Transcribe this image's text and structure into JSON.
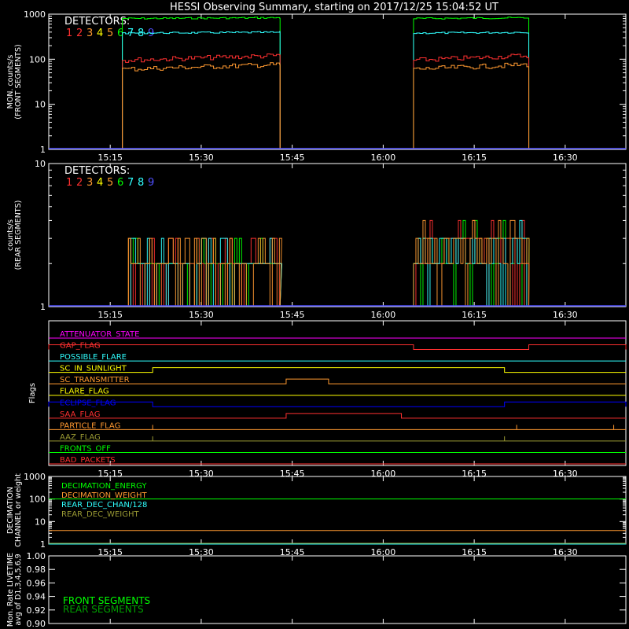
{
  "title": "HESSI Observing Summary, starting on 2017/12/25 15:04:52 UT",
  "colors": {
    "background": "#000000",
    "axes": "#ffffff",
    "det1": "#ff3030",
    "det2": "#ff3030",
    "det3": "#ff9930",
    "det4": "#ffff00",
    "det5": "#ff9930",
    "det6": "#00ff00",
    "det7": "#30ffff",
    "det8": "#30ffff",
    "det9": "#5050ff"
  },
  "time_ticks": [
    "15:15",
    "15:30",
    "15:45",
    "16:00",
    "16:15",
    "16:30"
  ],
  "chart_data": [
    {
      "type": "line",
      "ylabel": "MON. counts/s\n(FRONT SEGMENTS)",
      "yscale": "log",
      "ylim": [
        1,
        1000
      ],
      "yticks": [
        "1",
        "10",
        "100",
        "1000"
      ],
      "legend_title": "DETECTORS:",
      "legend_items": [
        "1",
        "2",
        "3",
        "4",
        "5",
        "6",
        "7",
        "8",
        "9"
      ],
      "intervals": [
        [
          "15:17",
          "15:43"
        ],
        [
          "16:05",
          "16:24"
        ]
      ],
      "series": [
        {
          "detector": "6",
          "color": "#00ff00",
          "level": 800
        },
        {
          "detector": "7",
          "color": "#30ffff",
          "level": 380
        },
        {
          "detector": "1",
          "color": "#ff3030",
          "level": 95
        },
        {
          "detector": "3",
          "color": "#ff9930",
          "level": 60
        }
      ]
    },
    {
      "type": "line",
      "ylabel": "counts/s\n(REAR SEGMENTS)",
      "yscale": "log",
      "ylim": [
        1,
        10
      ],
      "yticks": [
        "1",
        "10"
      ],
      "legend_title": "DETECTORS:",
      "legend_items": [
        "1",
        "2",
        "3",
        "4",
        "5",
        "6",
        "7",
        "8",
        "9"
      ],
      "intervals": [
        [
          "15:18",
          "15:43"
        ],
        [
          "16:05",
          "16:24"
        ]
      ],
      "levels": [
        1,
        2,
        3,
        4
      ]
    },
    {
      "type": "line",
      "ylabel": "Flags",
      "flags": [
        {
          "name": "ATTENUATOR_STATE",
          "color": "#ff00ff",
          "high": []
        },
        {
          "name": "GAP_FLAG",
          "color": "#ff3030",
          "high": [
            [
              "15:04:52",
              "16:05"
            ],
            [
              "16:24",
              "16:40"
            ]
          ]
        },
        {
          "name": "POSSIBLE_FLARE",
          "color": "#30ffff",
          "high": []
        },
        {
          "name": "SC_IN_SUNLIGHT",
          "color": "#ffff00",
          "high": [
            [
              "15:22",
              "16:20"
            ]
          ]
        },
        {
          "name": "SC_TRANSMITTER",
          "color": "#ff9930",
          "high": [
            [
              "15:44",
              "15:51"
            ]
          ]
        },
        {
          "name": "FLARE_FLAG",
          "color": "#ffff00",
          "high": []
        },
        {
          "name": "ECLIPSE_FLAG",
          "color": "#0000ff",
          "high": [
            [
              "15:04:52",
              "15:22"
            ],
            [
              "16:20",
              "16:40"
            ]
          ]
        },
        {
          "name": "SAA_FLAG",
          "color": "#ff3030",
          "high": [
            [
              "15:44",
              "16:03"
            ]
          ]
        },
        {
          "name": "PARTICLE_FLAG",
          "color": "#ff9930",
          "high": []
        },
        {
          "name": "AAZ_FLAG",
          "color": "#999933",
          "high": []
        },
        {
          "name": "FRONTS_OFF",
          "color": "#00ff00",
          "high": []
        },
        {
          "name": "BAD_PACKETS",
          "color": "#ff3030",
          "high": []
        }
      ]
    },
    {
      "type": "line",
      "ylabel": "DECIMATION\nCHANNEL or weight",
      "yscale": "log",
      "ylim": [
        1,
        1000
      ],
      "yticks": [
        "1",
        "10",
        "100",
        "1000"
      ],
      "series": [
        {
          "name": "DECIMATION_ENERGY",
          "color": "#00ff00",
          "level": 100
        },
        {
          "name": "DECIMATION_WEIGHT",
          "color": "#ff9930",
          "level": 4
        },
        {
          "name": "REAR_DEC_CHAN/128",
          "color": "#30ffff",
          "level": 1
        },
        {
          "name": "REAR_DEC_WEIGHT",
          "color": "#999933",
          "level": 1
        }
      ]
    },
    {
      "type": "line",
      "ylabel": "Mon. Rate LIVETIME\navg of D1,3,4,5,6,9",
      "ylim": [
        0.9,
        1.0
      ],
      "yticks": [
        "0.90",
        "0.92",
        "0.94",
        "0.96",
        "0.98",
        "1.00"
      ],
      "series": [
        {
          "name": "FRONT SEGMENTS",
          "color": "#00ff00"
        },
        {
          "name": "REAR SEGMENTS",
          "color": "#00a000"
        }
      ]
    }
  ]
}
